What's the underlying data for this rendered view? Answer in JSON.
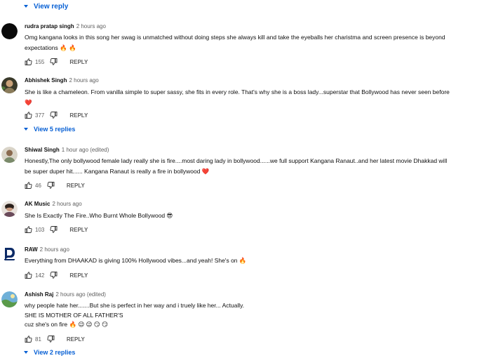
{
  "top_view_reply": "View reply",
  "comments": [
    {
      "author": "rudra pratap singh",
      "time": "2 hours ago",
      "lines": [
        "Omg kangana looks in this song her swag is unmatched without doing steps she always kill and take the eyeballs her charistma and screen presence is beyond",
        "expectations 🔥 🔥"
      ],
      "likes": "155",
      "reply": "REPLY"
    },
    {
      "author": "Abhishek Singh",
      "time": "2 hours ago",
      "lines": [
        "She is like a chameleon. From vanilla simple to super sassy, she fits in every role. That's why she is a boss lady...superstar that Bollywood has  never seen before",
        "❤️"
      ],
      "likes": "377",
      "reply": "REPLY",
      "view_replies": "View 5 replies"
    },
    {
      "author": "Shiwal Singh",
      "time": "1 hour ago (edited)",
      "lines": [
        "Honestly,The only bollywood female  lady really she is fire....most daring lady in bollywood......we full support Kangana Ranaut..and her latest movie Dhakkad will",
        "be super duper hit...... Kangana Ranaut is really a fire in bollywood ❤️"
      ],
      "likes": "46",
      "reply": "REPLY"
    },
    {
      "author": "AK Music",
      "time": "2 hours ago",
      "lines": [
        "She Is Exactly The Fire..Who Burnt Whole Bollywood 😎"
      ],
      "likes": "103",
      "reply": "REPLY"
    },
    {
      "author": "RAW",
      "time": "2 hours ago",
      "lines": [
        "Everything from DHAAKAD is giving 100% Hollywood vibes...and yeah! She's on 🔥"
      ],
      "likes": "142",
      "reply": "REPLY"
    },
    {
      "author": "Ashish Raj",
      "time": "2 hours ago (edited)",
      "lines": [
        "why people hate her.......But she is perfect in her way and i truely like her... Actually.",
        "SHE IS MOTHER OF ALL FATHER'S",
        "cuz she's on fire 🔥 😉 😉 😏 😏"
      ],
      "likes": "81",
      "reply": "REPLY",
      "view_replies": "View 2 replies"
    }
  ],
  "colors": {
    "link": "#065fd4",
    "meta": "#606060",
    "text": "#0f0f0f"
  },
  "icons": [
    "thumbs-up-icon",
    "thumbs-down-icon",
    "caret-down-icon"
  ]
}
